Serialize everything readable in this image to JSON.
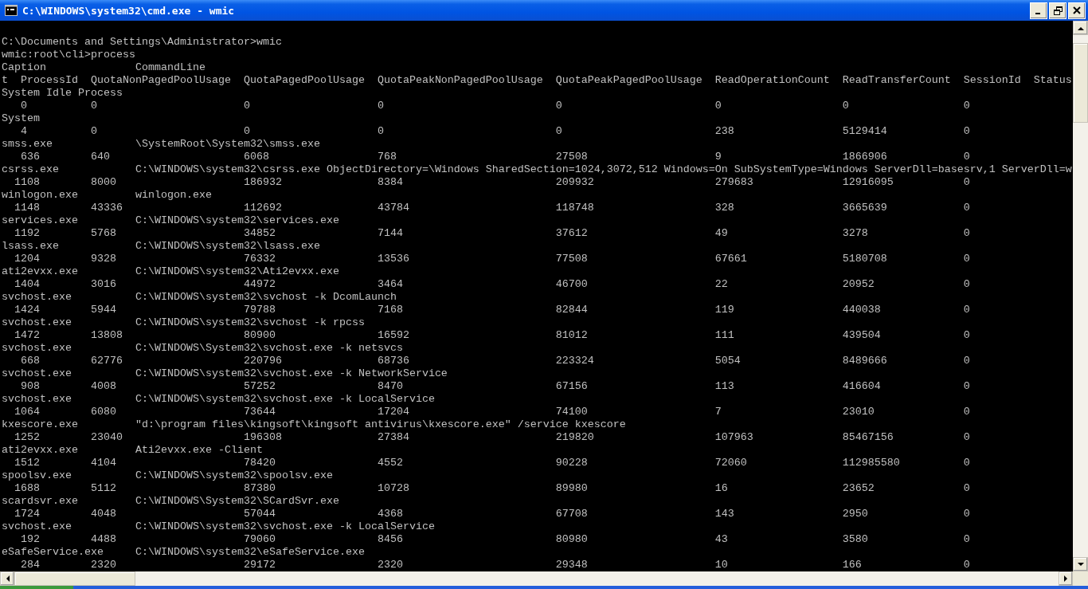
{
  "window": {
    "title": "C:\\WINDOWS\\system32\\cmd.exe - wmic"
  },
  "console": {
    "commands": [
      {
        "prompt": "C:\\Documents and Settings\\Administrator>",
        "input": "wmic"
      },
      {
        "prompt": "wmic:root\\cli>",
        "input": "process"
      }
    ],
    "header_line_1": [
      "Caption",
      "CommandLine"
    ],
    "header_line_2": [
      "t",
      "ProcessId",
      "QuotaNonPagedPoolUsage",
      "QuotaPagedPoolUsage",
      "QuotaPeakNonPagedPoolUsage",
      "QuotaPeakPagedPoolUsage",
      "ReadOperationCount",
      "ReadTransferCount",
      "SessionId",
      "Status"
    ],
    "processes": [
      {
        "caption": "System Idle Process",
        "values": [
          "0",
          "0",
          "0",
          "0",
          "0",
          "0",
          "0",
          "0"
        ]
      },
      {
        "caption": "System",
        "values": [
          "4",
          "0",
          "0",
          "0",
          "0",
          "238",
          "5129414",
          "0"
        ]
      },
      {
        "caption": "smss.exe",
        "command_line": "\\SystemRoot\\System32\\smss.exe",
        "values": [
          "636",
          "640",
          "6068",
          "768",
          "27508",
          "9",
          "1866906",
          "0"
        ]
      },
      {
        "caption": "csrss.exe",
        "command_line": "C:\\WINDOWS\\system32\\csrss.exe ObjectDirectory=\\Windows SharedSection=1024,3072,512 Windows=On SubSystemType=Windows ServerDll=basesrv,1 ServerDll=w",
        "values": [
          "1108",
          "8000",
          "186932",
          "8384",
          "209932",
          "279683",
          "12916095",
          "0"
        ]
      },
      {
        "caption": "winlogon.exe",
        "command_line": "winlogon.exe",
        "values": [
          "1148",
          "43336",
          "112692",
          "43784",
          "118748",
          "328",
          "3665639",
          "0"
        ]
      },
      {
        "caption": "services.exe",
        "command_line": "C:\\WINDOWS\\system32\\services.exe",
        "values": [
          "1192",
          "5768",
          "34852",
          "7144",
          "37612",
          "49",
          "3278",
          "0"
        ]
      },
      {
        "caption": "lsass.exe",
        "command_line": "C:\\WINDOWS\\system32\\lsass.exe",
        "values": [
          "1204",
          "9328",
          "76332",
          "13536",
          "77508",
          "67661",
          "5180708",
          "0"
        ]
      },
      {
        "caption": "ati2evxx.exe",
        "command_line": "C:\\WINDOWS\\system32\\Ati2evxx.exe",
        "values": [
          "1404",
          "3016",
          "44972",
          "3464",
          "46700",
          "22",
          "20952",
          "0"
        ]
      },
      {
        "caption": "svchost.exe",
        "command_line": "C:\\WINDOWS\\system32\\svchost -k DcomLaunch",
        "values": [
          "1424",
          "5944",
          "79788",
          "7168",
          "82844",
          "119",
          "440038",
          "0"
        ]
      },
      {
        "caption": "svchost.exe",
        "command_line": "C:\\WINDOWS\\system32\\svchost -k rpcss",
        "values": [
          "1472",
          "13808",
          "80900",
          "16592",
          "81012",
          "111",
          "439504",
          "0"
        ]
      },
      {
        "caption": "svchost.exe",
        "command_line": "C:\\WINDOWS\\System32\\svchost.exe -k netsvcs",
        "values": [
          "668",
          "62776",
          "220796",
          "68736",
          "223324",
          "5054",
          "8489666",
          "0"
        ]
      },
      {
        "caption": "svchost.exe",
        "command_line": "C:\\WINDOWS\\system32\\svchost.exe -k NetworkService",
        "values": [
          "908",
          "4008",
          "57252",
          "8470",
          "67156",
          "113",
          "416604",
          "0"
        ]
      },
      {
        "caption": "svchost.exe",
        "command_line": "C:\\WINDOWS\\system32\\svchost.exe -k LocalService",
        "values": [
          "1064",
          "6080",
          "73644",
          "17204",
          "74100",
          "7",
          "23010",
          "0"
        ]
      },
      {
        "caption": "kxescore.exe",
        "command_line": "\"d:\\program files\\kingsoft\\kingsoft antivirus\\kxescore.exe\" /service kxescore",
        "values": [
          "1252",
          "23040",
          "196308",
          "27384",
          "219820",
          "107963",
          "85467156",
          "0"
        ]
      },
      {
        "caption": "ati2evxx.exe",
        "command_line": "Ati2evxx.exe -Client",
        "values": [
          "1512",
          "4104",
          "78420",
          "4552",
          "90228",
          "72060",
          "112985580",
          "0"
        ]
      },
      {
        "caption": "spoolsv.exe",
        "command_line": "C:\\WINDOWS\\system32\\spoolsv.exe",
        "values": [
          "1688",
          "5112",
          "87380",
          "10728",
          "89980",
          "16",
          "23652",
          "0"
        ]
      },
      {
        "caption": "scardsvr.exe",
        "command_line": "C:\\WINDOWS\\System32\\SCardSvr.exe",
        "values": [
          "1724",
          "4048",
          "57044",
          "4368",
          "67708",
          "143",
          "2950",
          "0"
        ]
      },
      {
        "caption": "svchost.exe",
        "command_line": "C:\\WINDOWS\\system32\\svchost.exe -k LocalService",
        "values": [
          "192",
          "4488",
          "79060",
          "8456",
          "80980",
          "43",
          "3580",
          "0"
        ]
      },
      {
        "caption": "eSafeService.exe",
        "command_line": "C:\\WINDOWS\\system32\\eSafeService.exe",
        "values": [
          "284",
          "2320",
          "29172",
          "2320",
          "29348",
          "10",
          "166",
          "0"
        ]
      }
    ]
  }
}
